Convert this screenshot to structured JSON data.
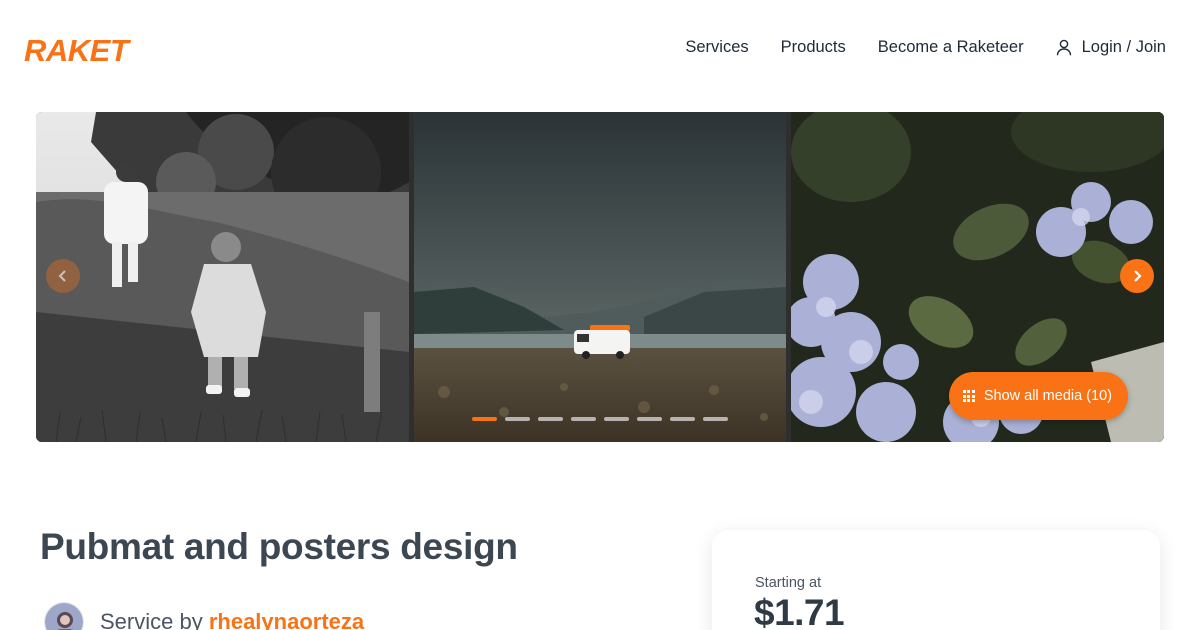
{
  "brand": {
    "name": "RAKET",
    "color": "#f97316"
  },
  "nav": {
    "items": [
      {
        "label": "Services"
      },
      {
        "label": "Products"
      },
      {
        "label": "Become a Raketeer"
      }
    ],
    "login_label": "Login / Join",
    "login_icon": "user-icon"
  },
  "gallery": {
    "media_button_label": "Show all media (10)",
    "media_button_icon": "grid-icon",
    "prev_icon": "chevron-left-icon",
    "next_icon": "chevron-right-icon",
    "dot_count": 8,
    "active_dot": 1
  },
  "service": {
    "title": "Pubmat and posters design",
    "by_prefix": "Service by ",
    "author": "rhealynaorteza"
  },
  "pricing": {
    "label": "Starting at",
    "price": "$1.71"
  }
}
